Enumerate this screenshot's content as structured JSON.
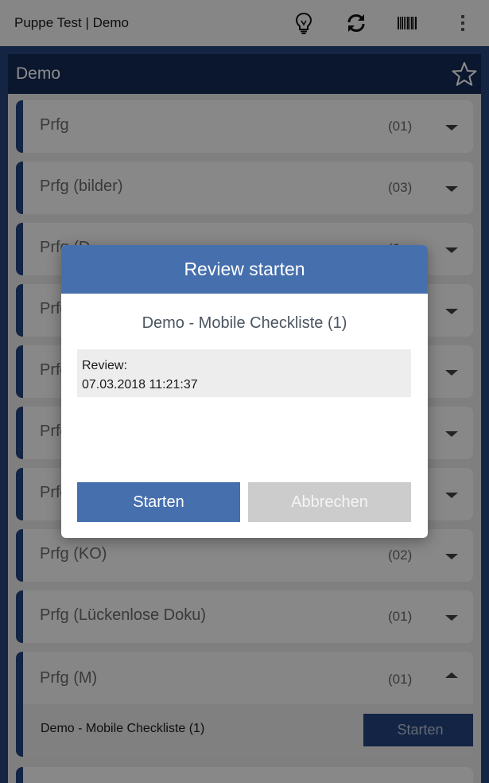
{
  "toolbar": {
    "title": "Puppe Test | Demo",
    "icons": [
      "lightbulb-icon",
      "sync-icon",
      "barcode-icon",
      "more-vert-icon"
    ]
  },
  "panel": {
    "title": "Demo",
    "star_icon": "star-outline-icon",
    "accent": "#24427c"
  },
  "list": {
    "items": [
      {
        "label": "Prfg",
        "count": "(01)"
      },
      {
        "label": "Prfg (bilder)",
        "count": "(03)"
      },
      {
        "label": "Prfg (D",
        "count": "(0"
      },
      {
        "label": "Prfg",
        "count": ""
      },
      {
        "label": "Prfg",
        "count": ""
      },
      {
        "label": "Prfg",
        "count": ""
      },
      {
        "label": "Prfg",
        "count": ""
      },
      {
        "label": "Prfg (KO)",
        "count": "(02)"
      },
      {
        "label": "Prfg (Lückenlose Doku)",
        "count": "(01)"
      }
    ],
    "expanded": {
      "label": "Prfg (M)",
      "count": "(01)",
      "entry_label": "Demo - Mobile Checkliste (1)",
      "entry_button": "Starten"
    }
  },
  "dialog": {
    "title": "Review starten",
    "subtitle": "Demo - Mobile Checkliste (1)",
    "review_label": "Review:",
    "review_value": "07.03.2018 11:21:37",
    "start_button": "Starten",
    "cancel_button": "Abbrechen",
    "primary_color": "#466fad"
  }
}
